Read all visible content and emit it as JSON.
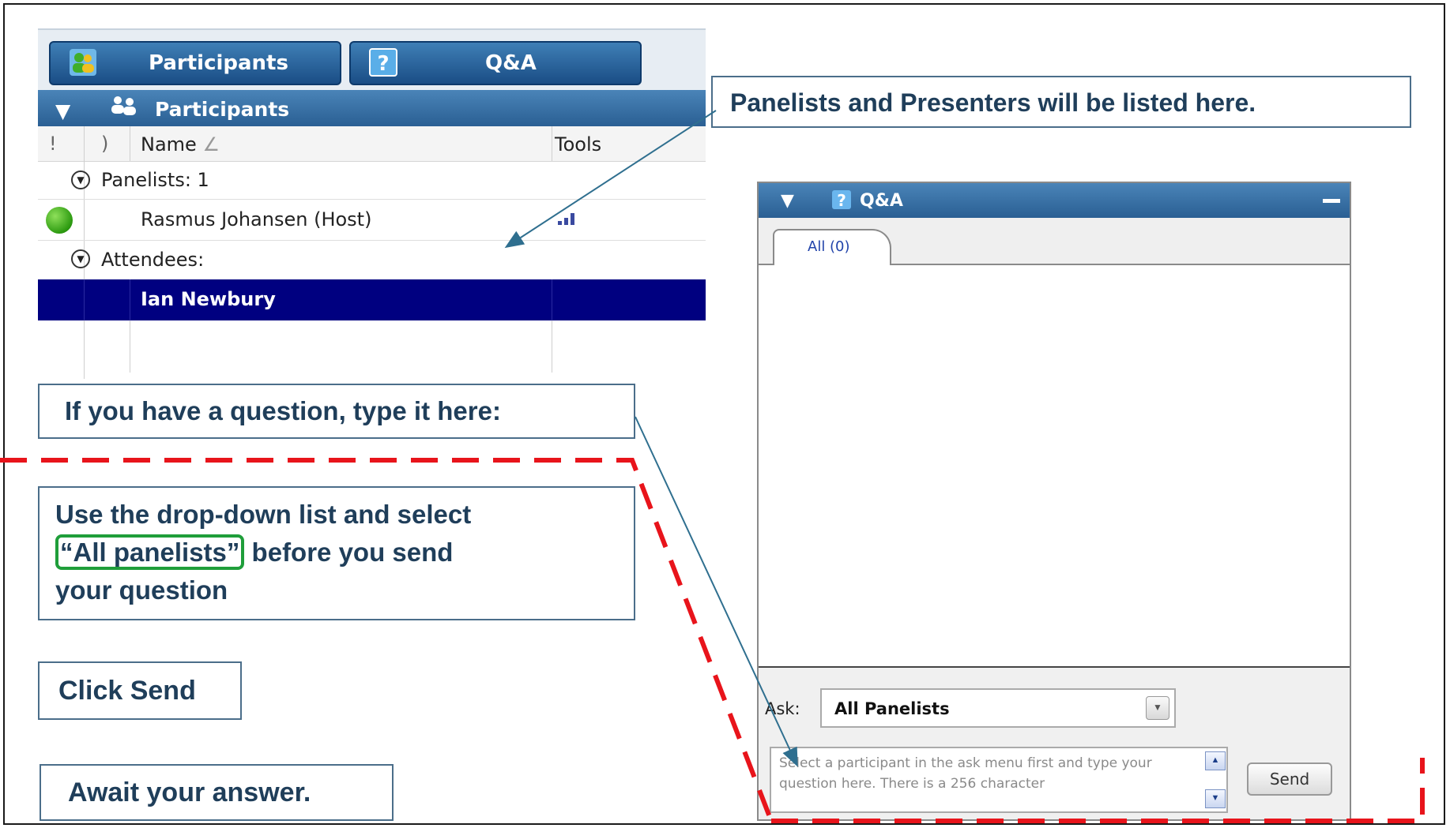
{
  "participants_panel": {
    "top_tabs": [
      {
        "label": "Participants",
        "icon": "participants-icon"
      },
      {
        "label": "Q&A",
        "icon": "question-icon"
      }
    ],
    "header": {
      "title": "Participants",
      "icon": "people-group-icon"
    },
    "columns": {
      "flag1": "!",
      "flag2": ")",
      "name": "Name",
      "sort_glyph": "∠",
      "tools": "Tools"
    },
    "groups": [
      {
        "label": "Panelists: 1",
        "members": [
          {
            "name": "Rasmus Johansen (Host)",
            "status": "online",
            "tools_icon": "signal-bars-icon"
          }
        ]
      },
      {
        "label": "Attendees:",
        "members": [
          {
            "name": "Ian Newbury",
            "selected": true
          }
        ]
      }
    ]
  },
  "callouts": {
    "panelists": "Panelists and Presenters will be listed here.",
    "question": "If you have a question, type it here:",
    "dropdown_line1": "Use the drop-down list and select",
    "dropdown_highlight": "“All panelists”",
    "dropdown_line2": " before you send",
    "dropdown_line3": "your question",
    "send": "Click Send",
    "await": "Await your answer."
  },
  "qa_panel": {
    "title": "Q&A",
    "tab": "All (0)",
    "ask_label": "Ask:",
    "ask_value": "All Panelists",
    "question_placeholder": "Select a participant in the ask menu first and type your question here. There is a 256 character",
    "send_label": "Send"
  },
  "colors": {
    "accent_blue": "#2a5f93",
    "selection_navy": "#000080",
    "callout_text": "#1f3e5a",
    "highlight_green": "#1f9e3a",
    "dashed_red": "#e8141b",
    "online_green": "#3cb01a"
  }
}
